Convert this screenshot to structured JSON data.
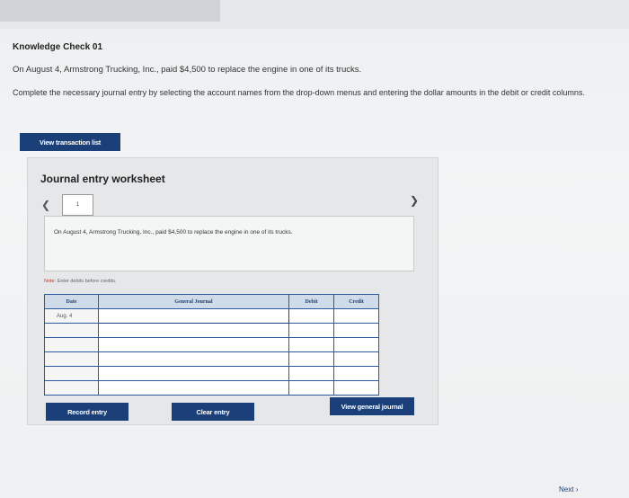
{
  "header": {
    "title": "Knowledge Check 01"
  },
  "question": {
    "text": "On August 4, Armstrong Trucking, Inc., paid $4,500 to replace the engine in one of its trucks.",
    "instructions": "Complete the necessary journal entry by selecting the account names from the drop-down menus and entering the dollar amounts in the debit or credit columns."
  },
  "buttons": {
    "view_transaction_list": "View transaction list",
    "record_entry": "Record entry",
    "clear_entry": "Clear entry",
    "view_general_journal": "View general journal"
  },
  "worksheet": {
    "title": "Journal entry worksheet",
    "page_number": "1",
    "prev_icon": "chevron-left-icon",
    "next_icon": "chevron-right-icon",
    "description": "On August 4, Armstrong Trucking, Inc., paid $4,500 to replace the engine in one of its trucks.",
    "note_label": "Note:",
    "note_text": "Enter debits before credits."
  },
  "table": {
    "headers": {
      "date": "Date",
      "general_journal": "General Journal",
      "debit": "Debit",
      "credit": "Credit"
    },
    "rows": [
      {
        "date": "Aug. 4",
        "account": "",
        "debit": "",
        "credit": ""
      },
      {
        "date": "",
        "account": "",
        "debit": "",
        "credit": ""
      },
      {
        "date": "",
        "account": "",
        "debit": "",
        "credit": ""
      },
      {
        "date": "",
        "account": "",
        "debit": "",
        "credit": ""
      },
      {
        "date": "",
        "account": "",
        "debit": "",
        "credit": ""
      },
      {
        "date": "",
        "account": "",
        "debit": "",
        "credit": ""
      }
    ]
  },
  "footer": {
    "next_label": "Next"
  },
  "colors": {
    "button_bg": "#1b3f78",
    "table_border": "#2a5aa0",
    "header_bg": "#cfdbe8"
  }
}
